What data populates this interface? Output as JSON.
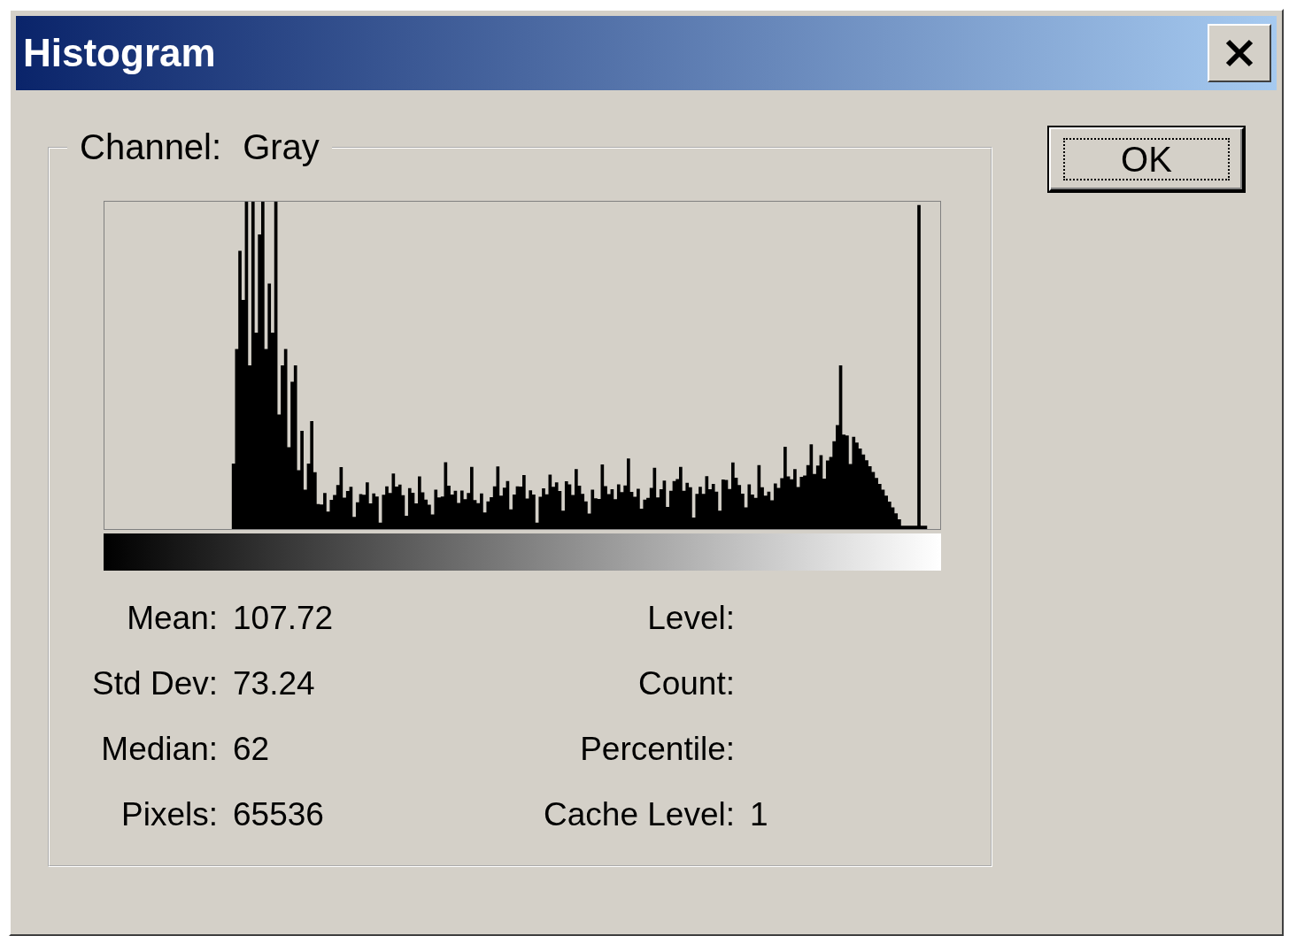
{
  "window": {
    "title": "Histogram"
  },
  "group": {
    "label": "Channel:",
    "channel": "Gray"
  },
  "buttons": [
    {
      "label": "OK",
      "focused": true
    }
  ],
  "stats_left": [
    {
      "label": "Mean:",
      "value": "107.72"
    },
    {
      "label": "Std Dev:",
      "value": "73.24"
    },
    {
      "label": "Median:",
      "value": "62"
    },
    {
      "label": "Pixels:",
      "value": "65536"
    }
  ],
  "stats_right": [
    {
      "label": "Level:"
    },
    {
      "label": "Count:"
    },
    {
      "label": "Percentile:"
    },
    {
      "label": "Cache Level:",
      "value": "1"
    }
  ]
}
